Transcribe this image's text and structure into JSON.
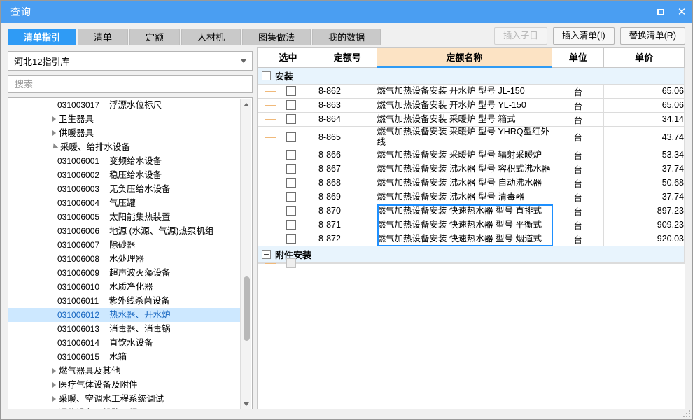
{
  "window": {
    "title": "查询",
    "controls": [
      {
        "name": "maximize",
        "glyph": "□"
      },
      {
        "name": "close",
        "glyph": "✕"
      }
    ]
  },
  "tabs": [
    {
      "label": "清单指引",
      "active": true
    },
    {
      "label": "清单",
      "active": false
    },
    {
      "label": "定额",
      "active": false
    },
    {
      "label": "人材机",
      "active": false
    },
    {
      "label": "图集做法",
      "active": false
    },
    {
      "label": "我的数据",
      "active": false
    }
  ],
  "toolbar": {
    "insert_sub_label": "插入子目",
    "insert_sub_disabled": true,
    "insert_list_label": "插入清单(I)",
    "replace_list_label": "替换清单(R)"
  },
  "left": {
    "library_select": {
      "value": "河北12指引库"
    },
    "search": {
      "value": "",
      "placeholder": "搜索"
    },
    "tree": [
      {
        "type": "leaf",
        "indent": 3,
        "code": "031003017",
        "name": "浮漂水位标尺",
        "selected": false
      },
      {
        "type": "group",
        "indent": 1,
        "name": "卫生器具",
        "expanded": false
      },
      {
        "type": "group",
        "indent": 1,
        "name": "供暖器具",
        "expanded": false
      },
      {
        "type": "group",
        "indent": 1,
        "name": "采暖、给排水设备",
        "expanded": true
      },
      {
        "type": "leaf",
        "indent": 3,
        "code": "031006001",
        "name": "变频给水设备",
        "selected": false
      },
      {
        "type": "leaf",
        "indent": 3,
        "code": "031006002",
        "name": "稳压给水设备",
        "selected": false
      },
      {
        "type": "leaf",
        "indent": 3,
        "code": "031006003",
        "name": "无负压给水设备",
        "selected": false
      },
      {
        "type": "leaf",
        "indent": 3,
        "code": "031006004",
        "name": "气压罐",
        "selected": false
      },
      {
        "type": "leaf",
        "indent": 3,
        "code": "031006005",
        "name": "太阳能集热装置",
        "selected": false
      },
      {
        "type": "leaf",
        "indent": 3,
        "code": "031006006",
        "name": "地源 (水源、气源)热泵机组",
        "selected": false
      },
      {
        "type": "leaf",
        "indent": 3,
        "code": "031006007",
        "name": "除砂器",
        "selected": false
      },
      {
        "type": "leaf",
        "indent": 3,
        "code": "031006008",
        "name": "水处理器",
        "selected": false
      },
      {
        "type": "leaf",
        "indent": 3,
        "code": "031006009",
        "name": "超声波灭藻设备",
        "selected": false
      },
      {
        "type": "leaf",
        "indent": 3,
        "code": "031006010",
        "name": "水质净化器",
        "selected": false
      },
      {
        "type": "leaf",
        "indent": 3,
        "code": "031006011",
        "name": "紫外线杀菌设备",
        "selected": false
      },
      {
        "type": "leaf",
        "indent": 3,
        "code": "031006012",
        "name": "热水器、开水炉",
        "selected": true
      },
      {
        "type": "leaf",
        "indent": 3,
        "code": "031006013",
        "name": "消毒器、消毒锅",
        "selected": false
      },
      {
        "type": "leaf",
        "indent": 3,
        "code": "031006014",
        "name": "直饮水设备",
        "selected": false
      },
      {
        "type": "leaf",
        "indent": 3,
        "code": "031006015",
        "name": "水箱",
        "selected": false
      },
      {
        "type": "group",
        "indent": 1,
        "name": "燃气器具及其他",
        "expanded": false
      },
      {
        "type": "group",
        "indent": 1,
        "name": "医疗气体设备及附件",
        "expanded": false
      },
      {
        "type": "group",
        "indent": 1,
        "name": "采暖、空调水工程系统调试",
        "expanded": false
      },
      {
        "type": "group",
        "indent": 1,
        "name": "通信设备及线路工程",
        "expanded": false
      }
    ]
  },
  "grid": {
    "columns": [
      {
        "key": "check",
        "label": "选中",
        "highlight": false
      },
      {
        "key": "code",
        "label": "定额号",
        "highlight": false
      },
      {
        "key": "name",
        "label": "定额名称",
        "highlight": true
      },
      {
        "key": "unit",
        "label": "单位",
        "highlight": false
      },
      {
        "key": "price",
        "label": "单价",
        "highlight": false
      }
    ],
    "rows": [
      {
        "kind": "group",
        "label": "安装",
        "expanded": true
      },
      {
        "kind": "item",
        "checked": false,
        "code": "8-862",
        "name": "燃气加热设备安装 开水炉 型号 JL-150",
        "unit": "台",
        "price": "65.06",
        "selected": false
      },
      {
        "kind": "item",
        "checked": false,
        "code": "8-863",
        "name": "燃气加热设备安装 开水炉 型号 YL-150",
        "unit": "台",
        "price": "65.06",
        "selected": false
      },
      {
        "kind": "item",
        "checked": false,
        "code": "8-864",
        "name": "燃气加热设备安装 采暖炉 型号 箱式",
        "unit": "台",
        "price": "34.14",
        "selected": false
      },
      {
        "kind": "item",
        "checked": false,
        "code": "8-865",
        "name": "燃气加热设备安装 采暖炉 型号 YHRQ型红外线",
        "unit": "台",
        "price": "43.74",
        "selected": false
      },
      {
        "kind": "item",
        "checked": false,
        "code": "8-866",
        "name": "燃气加热设备安装 采暖炉 型号 辐射采暖炉",
        "unit": "台",
        "price": "53.34",
        "selected": false
      },
      {
        "kind": "item",
        "checked": false,
        "code": "8-867",
        "name": "燃气加热设备安装 沸水器 型号 容积式沸水器",
        "unit": "台",
        "price": "37.74",
        "selected": false
      },
      {
        "kind": "item",
        "checked": false,
        "code": "8-868",
        "name": "燃气加热设备安装 沸水器 型号 自动沸水器",
        "unit": "台",
        "price": "50.68",
        "selected": false
      },
      {
        "kind": "item",
        "checked": false,
        "code": "8-869",
        "name": "燃气加热设备安装 沸水器 型号 清毒器",
        "unit": "台",
        "price": "37.74",
        "selected": false
      },
      {
        "kind": "item",
        "checked": false,
        "code": "8-870",
        "name": "燃气加热设备安装 快速热水器 型号 直排式",
        "unit": "台",
        "price": "897.23",
        "selected": true
      },
      {
        "kind": "item",
        "checked": false,
        "code": "8-871",
        "name": "燃气加热设备安装 快速热水器 型号 平衡式",
        "unit": "台",
        "price": "909.23",
        "selected": true
      },
      {
        "kind": "item",
        "checked": false,
        "code": "8-872",
        "name": "燃气加热设备安装 快速热水器 型号 烟道式",
        "unit": "台",
        "price": "920.03",
        "selected": true
      },
      {
        "kind": "group",
        "label": "附件安装",
        "expanded": true
      },
      {
        "kind": "item",
        "checked": false,
        "checkbox_disabled": true,
        "code": "",
        "name": "",
        "unit": "",
        "price": "",
        "selected": false
      }
    ]
  },
  "colors": {
    "title_bar": "#4a9ef2",
    "active_tab": "#2f9bf5",
    "header_highlight": "#fce3c4",
    "group_row": "#e8f4fd",
    "selection_border": "#1e90ff",
    "tree_selection": "#cde8ff"
  }
}
